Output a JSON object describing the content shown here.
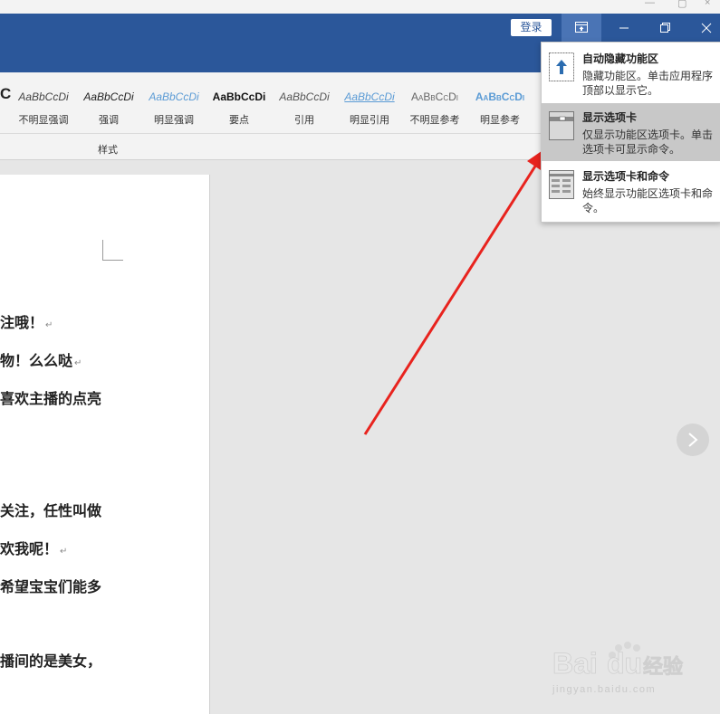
{
  "titlebar": {
    "login_label": "登录"
  },
  "ribbon": {
    "styles": [
      {
        "sample": "AaBbCcDi",
        "name": "不明显强调"
      },
      {
        "sample": "AaBbCcDi",
        "name": "强调"
      },
      {
        "sample": "AaBbCcDi",
        "name": "明显强调"
      },
      {
        "sample": "AaBbCcDi",
        "name": "要点"
      },
      {
        "sample": "AaBbCcDi",
        "name": "引用"
      },
      {
        "sample": "AaBbCcDi",
        "name": "明显引用"
      },
      {
        "sample": "AaBbCcDi",
        "name": "不明显参考"
      },
      {
        "sample": "AaBbCcDi",
        "name": "明显参考"
      }
    ],
    "group_label": "样式"
  },
  "document": {
    "lines": [
      "注哦！",
      "物！么么哒",
      "喜欢主播的点亮",
      "关注，任性叫做",
      "欢我呢！",
      "希望宝宝们能多",
      "播间的是美女，"
    ]
  },
  "ribbon_options_menu": {
    "items": [
      {
        "title": "自动隐藏功能区",
        "desc": "隐藏功能区。单击应用程序顶部以显示它。",
        "icon": "auto-hide-ribbon-icon"
      },
      {
        "title": "显示选项卡",
        "desc": "仅显示功能区选项卡。单击选项卡可显示命令。",
        "icon": "show-tabs-icon",
        "selected": true
      },
      {
        "title": "显示选项卡和命令",
        "desc": "始终显示功能区选项卡和命令。",
        "icon": "show-tabs-commands-icon"
      }
    ]
  },
  "watermark": {
    "brand": "Bai du 经验",
    "domain": "jingyan.baidu.com"
  },
  "colors": {
    "titlebar": "#2b579a",
    "ribbon_bg": "#f3f3f3",
    "arrow": "#e8231e",
    "menu_selected": "#c8c8c8"
  }
}
